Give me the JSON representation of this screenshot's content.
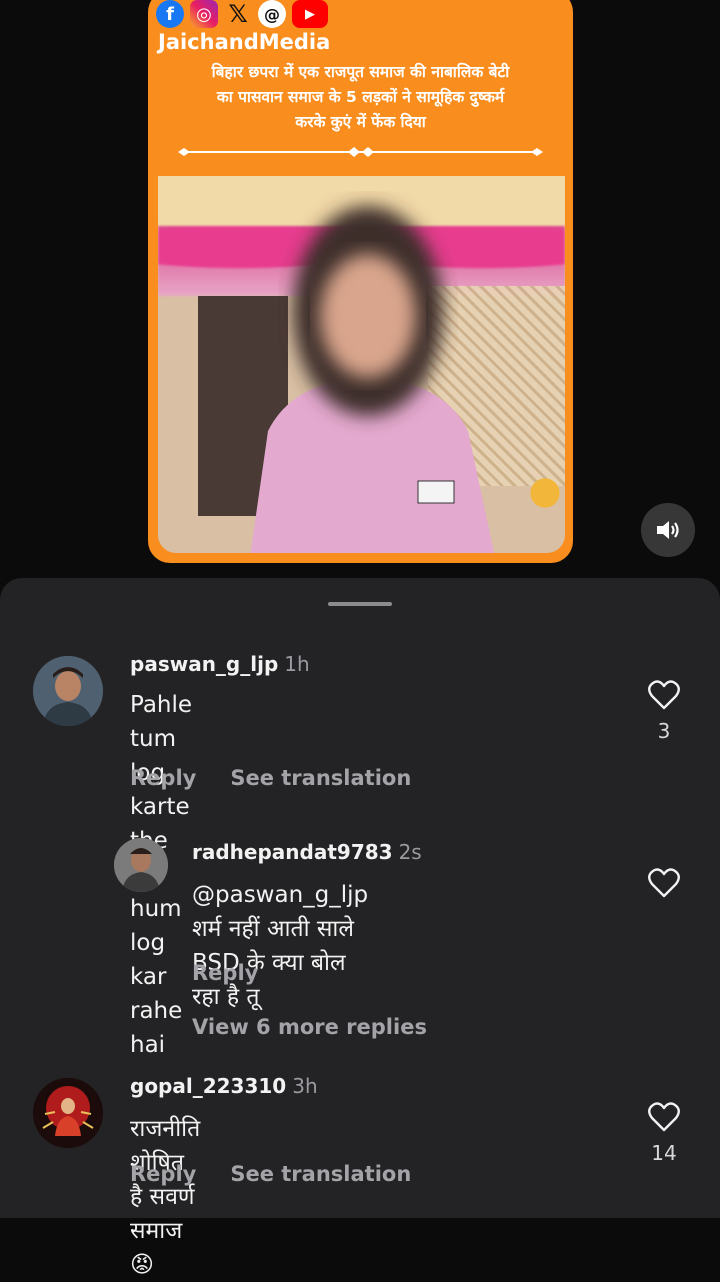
{
  "post": {
    "brand": "JaichandMedia",
    "headline_line1": "बिहार छपरा में एक राजपूत समाज की नाबालिक बेटी",
    "headline_line2": "का पासवान समाज के 5 लड़कों ने सामूहिक दुष्कर्म",
    "headline_line3": "करके कुएं में फेंक दिया",
    "social_icons": [
      "facebook-icon",
      "instagram-icon",
      "x-icon",
      "threads-icon",
      "youtube-icon"
    ],
    "accent_color": "#f98d1d"
  },
  "comments": [
    {
      "username": "paswan_g_ljp",
      "time": "1h",
      "text_line1": "Pahle tum log karte the ab hum log",
      "text_line2": "kar rahe hai",
      "likes": "3",
      "reply_label": "Reply",
      "translate_label": "See translation"
    },
    {
      "username": "radhepandat9783",
      "time": "2s",
      "mention": "@paswan_g_ljp",
      "text_line1": " शर्म नहीं आती साले",
      "text_line2": "BSD के क्या बोल रहा है तू",
      "reply_label": "Reply"
    },
    {
      "username": "gopal_223310",
      "time": "3h",
      "text_line1": "राजनीति शोषित है सवर्ण समाज",
      "emoji": "😡",
      "likes": "14",
      "reply_label": "Reply",
      "translate_label": "See translation"
    }
  ],
  "view_more": "View 6 more replies"
}
